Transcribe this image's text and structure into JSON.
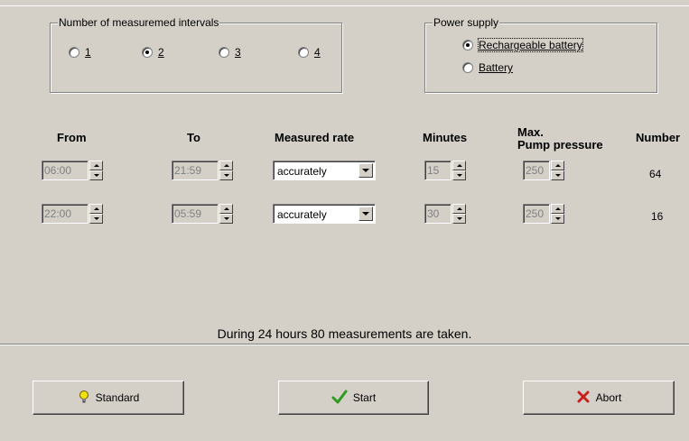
{
  "intervals": {
    "title": "Number of measuremed intervals",
    "options": [
      {
        "label": "1",
        "selected": false
      },
      {
        "label": "2",
        "selected": true
      },
      {
        "label": "3",
        "selected": false
      },
      {
        "label": "4",
        "selected": false
      }
    ]
  },
  "power": {
    "title": "Power supply",
    "options": [
      {
        "label": "Rechargeable battery",
        "selected": true
      },
      {
        "label": "Battery",
        "selected": false
      }
    ]
  },
  "headers": {
    "from": "From",
    "to": "To",
    "rate": "Measured rate",
    "minutes": "Minutes",
    "pressure": "Max.\nPump pressure",
    "number": "Number"
  },
  "rows": [
    {
      "from": "06:00",
      "to": "21:59",
      "rate": "accurately",
      "minutes": "15",
      "pressure": "250",
      "number": "64"
    },
    {
      "from": "22:00",
      "to": "05:59",
      "rate": "accurately",
      "minutes": "30",
      "pressure": "250",
      "number": "16"
    }
  ],
  "summary": "During 24 hours  80 measurements are taken.",
  "buttons": {
    "standard": "Standard",
    "start": "Start",
    "abort": "Abort"
  },
  "icons": {
    "standard": "lightbulb-icon",
    "start": "checkmark-icon",
    "abort": "x-icon"
  },
  "colors": {
    "face": "#d4d0c8",
    "start_icon": "#2e9a1e",
    "abort_icon": "#c81e1e",
    "bulb_icon": "#f2e20a"
  }
}
